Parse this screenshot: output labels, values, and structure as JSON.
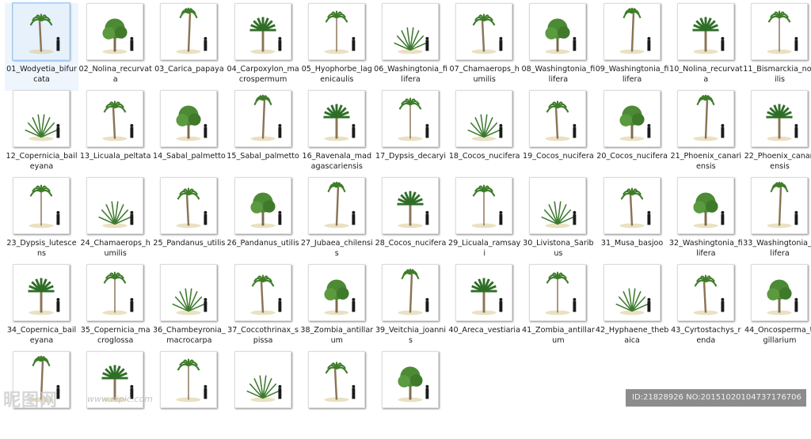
{
  "items": [
    {
      "label": "01_Wodyetia_bifurcata",
      "selected": true
    },
    {
      "label": "02_Nolina_recurvata"
    },
    {
      "label": "03_Carica_papaya"
    },
    {
      "label": "04_Carpoxylon_macrospermum"
    },
    {
      "label": "05_Hyophorbe_lagenicaulis"
    },
    {
      "label": "06_Washingtonia_filifera"
    },
    {
      "label": "07_Chamaerops_humilis"
    },
    {
      "label": "08_Washingtonia_filifera"
    },
    {
      "label": "09_Washingtonia_filifera"
    },
    {
      "label": "10_Nolina_recurvata"
    },
    {
      "label": "11_Bismarckia_nobilis"
    },
    {
      "label": "12_Copernicia_baileyana"
    },
    {
      "label": "13_Licuala_peltata"
    },
    {
      "label": "14_Sabal_palmetto"
    },
    {
      "label": "15_Sabal_palmetto"
    },
    {
      "label": "16_Ravenala_madagascariensis"
    },
    {
      "label": "17_Dypsis_decaryi"
    },
    {
      "label": "18_Cocos_nucifera"
    },
    {
      "label": "19_Cocos_nucifera"
    },
    {
      "label": "20_Cocos_nucifera"
    },
    {
      "label": "21_Phoenix_canariensis"
    },
    {
      "label": "22_Phoenix_canariensis"
    },
    {
      "label": "23_Dypsis_lutescens"
    },
    {
      "label": "24_Chamaerops_humilis"
    },
    {
      "label": "25_Pandanus_utilis"
    },
    {
      "label": "26_Pandanus_utilis"
    },
    {
      "label": "27_Jubaea_chilensis"
    },
    {
      "label": "28_Cocos_nucifera"
    },
    {
      "label": "29_Licuala_ramsayi"
    },
    {
      "label": "30_Livistona_Saribus"
    },
    {
      "label": "31_Musa_basjoo"
    },
    {
      "label": "32_Washingtonia_filifera"
    },
    {
      "label": "33_Washingtonia_filifera"
    },
    {
      "label": "34_Copernica_baileyana"
    },
    {
      "label": "35_Copernicia_macroglossa"
    },
    {
      "label": "36_Chambeyronia_macrocarpa"
    },
    {
      "label": "37_Coccothrinax_spissa"
    },
    {
      "label": "38_Zombia_antillarum"
    },
    {
      "label": "39_Veitchia_joannis"
    },
    {
      "label": "40_Areca_vestiaria"
    },
    {
      "label": "41_Zombia_antillarum"
    },
    {
      "label": "42_Hyphaene_thebaica"
    },
    {
      "label": "43_Cyrtostachys_renda"
    },
    {
      "label": "44_Oncosperma_tigillarium"
    },
    {
      "label": ""
    },
    {
      "label": ""
    },
    {
      "label": ""
    },
    {
      "label": ""
    },
    {
      "label": ""
    },
    {
      "label": ""
    }
  ],
  "watermark": "昵图网",
  "watermark_url": "www.nipic.com",
  "id_bar": "ID:21828926 NO:20151020104737176706"
}
